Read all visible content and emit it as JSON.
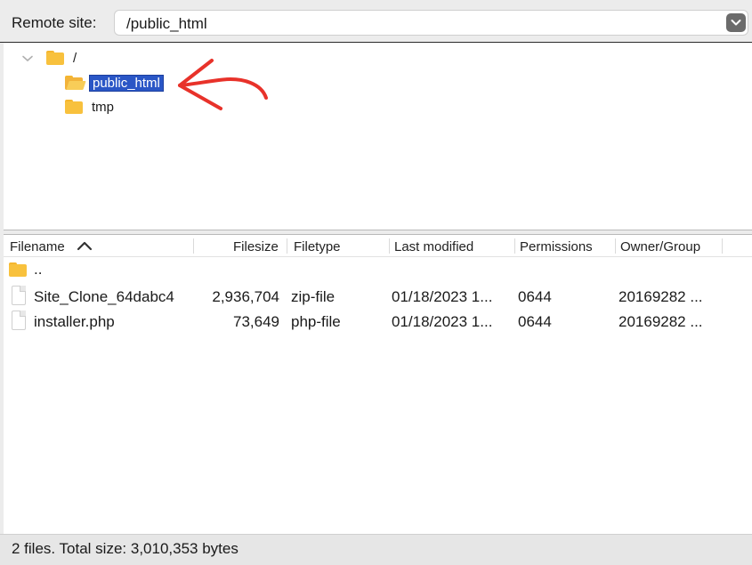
{
  "path_bar": {
    "label": "Remote site:",
    "value": "/public_html"
  },
  "tree": {
    "root": "/",
    "children": [
      {
        "name": "public_html",
        "selected": true
      },
      {
        "name": "tmp",
        "selected": false
      }
    ]
  },
  "file_list": {
    "columns": [
      "Filename",
      "Filesize",
      "Filetype",
      "Last modified",
      "Permissions",
      "Owner/Group"
    ],
    "parent_dir": "..",
    "rows": [
      {
        "filename": "Site_Clone_64dabc4",
        "filesize": "2,936,704",
        "filetype": "zip-file",
        "modified": "01/18/2023 1...",
        "permissions": "0644",
        "owner": "20169282 ..."
      },
      {
        "filename": "installer.php",
        "filesize": "73,649",
        "filetype": "php-file",
        "modified": "01/18/2023 1...",
        "permissions": "0644",
        "owner": "20169282 ..."
      }
    ]
  },
  "status_bar": {
    "text": "2 files. Total size: 3,010,353 bytes"
  },
  "colors": {
    "selection": "#2a56c6",
    "folder": "#f8c13d",
    "annotation_arrow": "#e8322a"
  },
  "icons": {
    "folder": "folder-icon",
    "file": "file-icon",
    "sort": "sort-ascending-icon",
    "dropdown": "chevron-down-icon",
    "tree_expander": "chevron-down-icon"
  }
}
